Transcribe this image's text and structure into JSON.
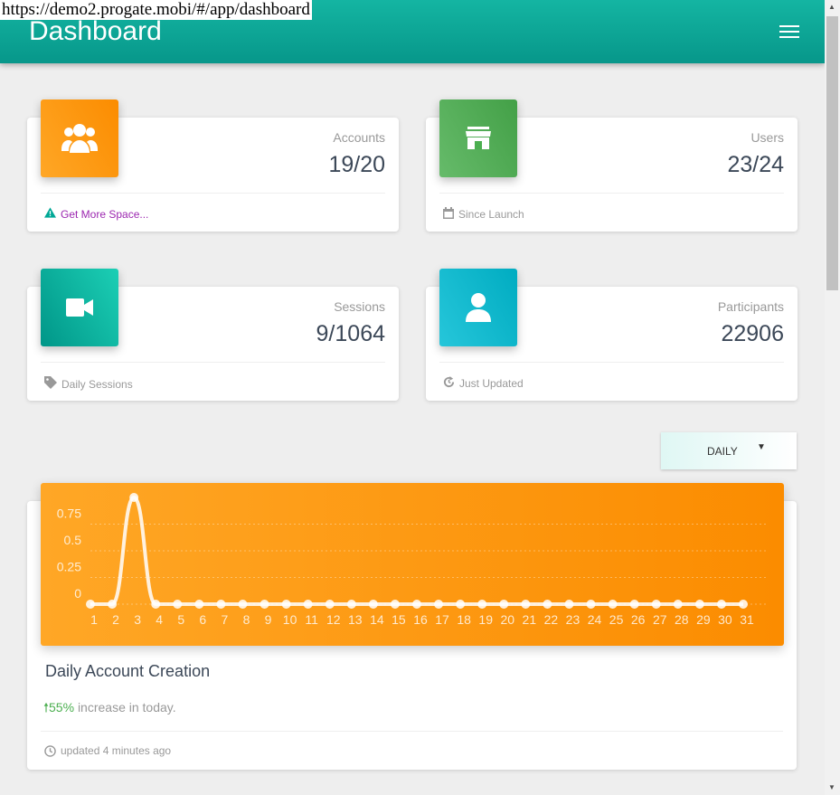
{
  "url": "https://demo2.progate.mobi/#/app/dashboard",
  "header": {
    "title": "Dashboard"
  },
  "stats": [
    {
      "label": "Accounts",
      "value": "19/20",
      "footer": "Get More Space...",
      "icon": "users-icon",
      "footer_icon": "warning-icon",
      "color": "#ff9800"
    },
    {
      "label": "Users",
      "value": "23/24",
      "footer": "Since Launch",
      "icon": "store-icon",
      "footer_icon": "calendar-icon",
      "color": "#4caf50"
    },
    {
      "label": "Sessions",
      "value": "9/1064",
      "footer": "Daily Sessions",
      "icon": "video-icon",
      "footer_icon": "tag-icon",
      "color": "#00a896"
    },
    {
      "label": "Participants",
      "value": "22906",
      "footer": "Just Updated",
      "icon": "person-icon",
      "footer_icon": "refresh-icon",
      "color": "#00acc1"
    }
  ],
  "dropdown": {
    "selected": "DAILY"
  },
  "chart_card": {
    "title": "Daily Account Creation",
    "increase": "55%",
    "increase_text": "increase in today.",
    "updated": "updated 4 minutes ago"
  },
  "chart_data": {
    "type": "line",
    "x": [
      1,
      2,
      3,
      4,
      5,
      6,
      7,
      8,
      9,
      10,
      11,
      12,
      13,
      14,
      15,
      16,
      17,
      18,
      19,
      20,
      21,
      22,
      23,
      24,
      25,
      26,
      27,
      28,
      29,
      30,
      31
    ],
    "values": [
      0,
      0,
      1,
      0,
      0,
      0,
      0,
      0,
      0,
      0,
      0,
      0,
      0,
      0,
      0,
      0,
      0,
      0,
      0,
      0,
      0,
      0,
      0,
      0,
      0,
      0,
      0,
      0,
      0,
      0,
      0
    ],
    "yticks": [
      "0",
      "0.25",
      "0.5",
      "0.75"
    ],
    "ylim": [
      0,
      1
    ],
    "grid": true
  }
}
